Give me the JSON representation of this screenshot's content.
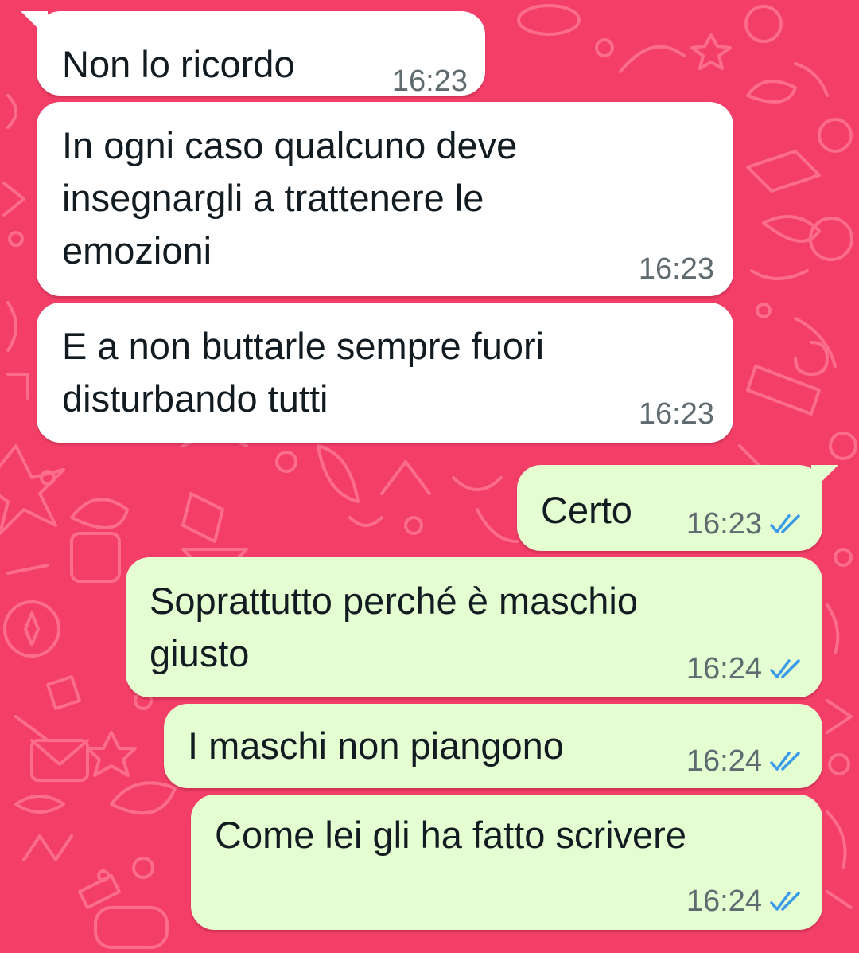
{
  "theme": {
    "background": "#f33f68",
    "incoming_bubble": "#ffffff",
    "outgoing_bubble": "#e4fed2",
    "read_tick_color": "#3a9ae8"
  },
  "messages": [
    {
      "direction": "incoming",
      "lines": [
        "Non lo ricordo"
      ],
      "time": "16:23"
    },
    {
      "direction": "incoming",
      "lines": [
        "In ogni caso qualcuno deve",
        "insegnargli a trattenere le",
        "emozioni"
      ],
      "time": "16:23"
    },
    {
      "direction": "incoming",
      "lines": [
        "E a non buttarle sempre fuori",
        "disturbando tutti"
      ],
      "time": "16:23"
    },
    {
      "direction": "outgoing",
      "lines": [
        "Certo"
      ],
      "time": "16:23",
      "status_icon": "double-check-read-icon"
    },
    {
      "direction": "outgoing",
      "lines": [
        "Soprattutto perché è maschio",
        "giusto"
      ],
      "time": "16:24",
      "status_icon": "double-check-read-icon"
    },
    {
      "direction": "outgoing",
      "lines": [
        "I maschi non piangono"
      ],
      "time": "16:24",
      "status_icon": "double-check-read-icon"
    },
    {
      "direction": "outgoing",
      "lines": [
        "Come lei gli ha fatto scrivere"
      ],
      "time": "16:24",
      "status_icon": "double-check-read-icon"
    }
  ]
}
